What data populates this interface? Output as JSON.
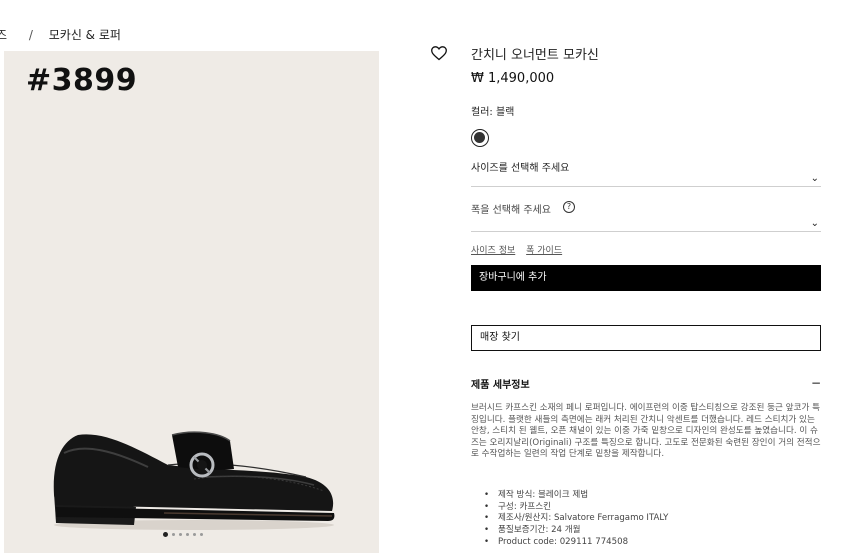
{
  "breadcrumb": {
    "prev": "즈",
    "separator": "/",
    "current": "모카신 & 로퍼"
  },
  "gallery": {
    "sku_overlay": "#3899",
    "image_alt": "black-penny-loafer",
    "dots_count": 6,
    "active_dot": 0
  },
  "product": {
    "title": "간치니 오너먼트 모카신",
    "price": "₩ 1,490,000",
    "color_label": "컬러: 블랙",
    "swatch_color": "#333333"
  },
  "size_select": {
    "placeholder": "사이즈를 선택해 주세요",
    "chevron": "⌄"
  },
  "width_select": {
    "placeholder": "폭을 선택해 주세요",
    "info": "?",
    "chevron": "⌄"
  },
  "guides": {
    "size_info": "사이즈 정보",
    "width_guide": "폭 가이드"
  },
  "actions": {
    "add_to_cart": "장바구니에 추가",
    "find_store": "매장 찾기"
  },
  "details": {
    "heading": "제품 세부정보",
    "toggle": "−",
    "description": "브러시드 카프스킨 소재의 페니 로퍼입니다. 에이프런의 이중 탑스티칭으로 강조된 둥근 앞코가 특징입니다. 플랫한 새들의 측면에는 래커 처리된 간치니 악센트를 더했습니다. 레드 스티치가 있는 안창, 스티치 된 웰트, 오픈 채널이 있는 이중 가죽 밑창으로 디자인의 완성도를 높였습니다. 이 슈즈는 오리지날리(Originali) 구조를 특징으로 합니다. 고도로 전문화된 숙련된 장인이 거의 전적으로 수작업하는 일련의 작업 단계로 밑창을 제작합니다.",
    "specs": [
      "제작 방식: 블레이크 제법",
      "구성: 카프스킨",
      "제조사/원산지: Salvatore Ferragamo ITALY",
      "품질보증기간: 24 개월",
      "Product code: 029111 774508"
    ]
  }
}
